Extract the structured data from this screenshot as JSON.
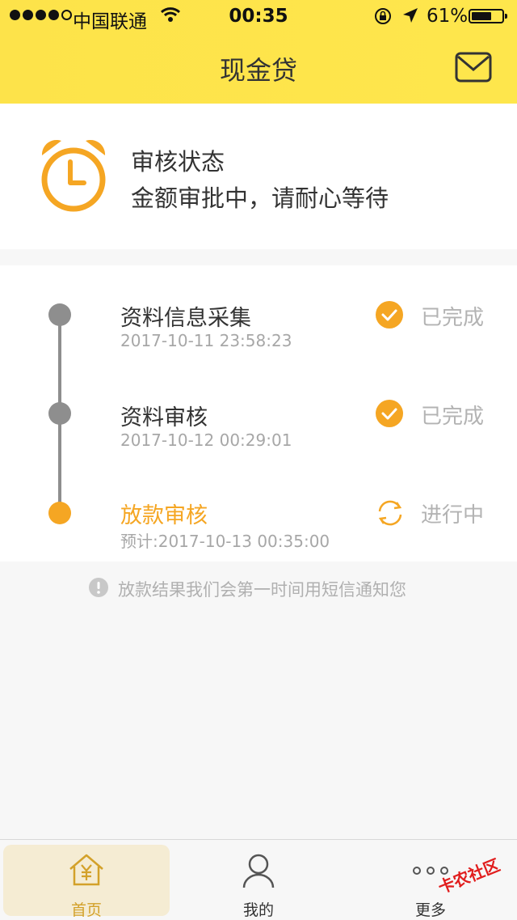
{
  "status_bar": {
    "carrier": "中国联通",
    "time": "00:35",
    "battery": "61%"
  },
  "header": {
    "title": "现金贷"
  },
  "status_card": {
    "title": "审核状态",
    "subtitle": "金额审批中，请耐心等待"
  },
  "steps": [
    {
      "title": "资料信息采集",
      "time": "2017-10-11 23:58:23",
      "status": "已完成"
    },
    {
      "title": "资料审核",
      "time": "2017-10-12 00:29:01",
      "status": "已完成"
    },
    {
      "title": "放款审核",
      "time": "预计:2017-10-13 00:35:00",
      "status": "进行中"
    }
  ],
  "notice": "放款结果我们会第一时间用短信通知您",
  "tabs": [
    {
      "label": "首页"
    },
    {
      "label": "我的"
    },
    {
      "label": "更多"
    }
  ],
  "watermark": "卡农社区",
  "colors": {
    "accent": "#f5a623",
    "header_bg": "#fee64c",
    "muted": "#a7a7a7"
  }
}
